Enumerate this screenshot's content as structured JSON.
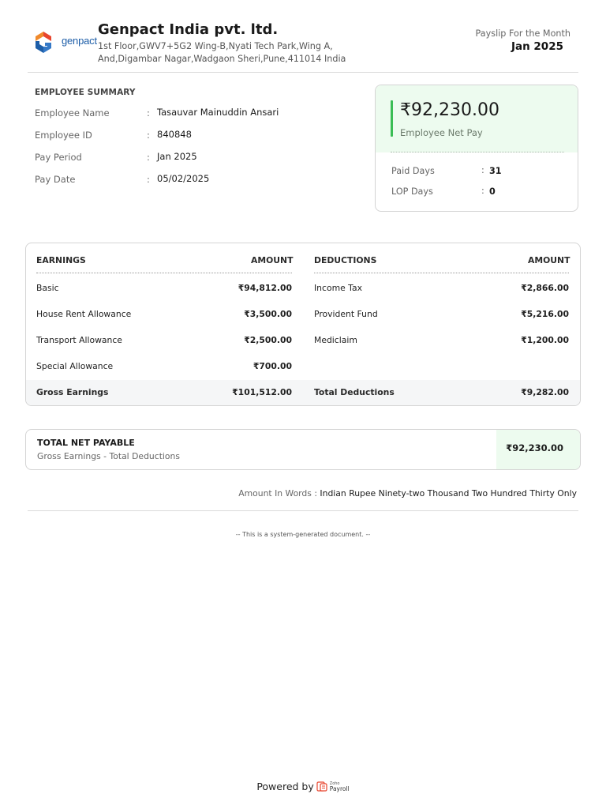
{
  "header": {
    "logo_text": "genpact",
    "company_name": "Genpact India pvt. ltd.",
    "address_line1": "1st Floor,GWV7+5G2 Wing-B,Nyati Tech Park,Wing A,",
    "address_line2": "And,Digambar Nagar,Wadgaon Sheri,Pune,411014 India",
    "payslip_label": "Payslip For the Month",
    "payslip_month": "Jan 2025"
  },
  "employee_summary": {
    "title": "EMPLOYEE SUMMARY",
    "rows": [
      {
        "label": "Employee Name",
        "value": "Tasauvar Mainuddin Ansari"
      },
      {
        "label": "Employee ID",
        "value": "840848"
      },
      {
        "label": "Pay Period",
        "value": "Jan 2025"
      },
      {
        "label": "Pay Date",
        "value": "05/02/2025"
      }
    ]
  },
  "net_pay_card": {
    "amount": "₹92,230.00",
    "label": "Employee Net Pay",
    "paid_days_label": "Paid Days",
    "paid_days_value": "31",
    "lop_days_label": "LOP Days",
    "lop_days_value": "0"
  },
  "earnings_table": {
    "earnings_header": "EARNINGS",
    "amount_header": "AMOUNT",
    "deductions_header": "DEDUCTIONS",
    "earnings": [
      {
        "label": "Basic",
        "amount": "₹94,812.00"
      },
      {
        "label": "House Rent Allowance",
        "amount": "₹3,500.00"
      },
      {
        "label": "Transport Allowance",
        "amount": "₹2,500.00"
      },
      {
        "label": "Special Allowance",
        "amount": "₹700.00"
      }
    ],
    "deductions": [
      {
        "label": "Income Tax",
        "amount": "₹2,866.00"
      },
      {
        "label": "Provident Fund",
        "amount": "₹5,216.00"
      },
      {
        "label": "Mediclaim",
        "amount": "₹1,200.00"
      }
    ],
    "gross_earnings_label": "Gross Earnings",
    "gross_earnings_amount": "₹101,512.00",
    "total_deductions_label": "Total Deductions",
    "total_deductions_amount": "₹9,282.00"
  },
  "total_net_payable": {
    "title": "TOTAL NET PAYABLE",
    "subtitle": "Gross Earnings - Total Deductions",
    "amount": "₹92,230.00"
  },
  "amount_in_words": {
    "label": "Amount In Words : ",
    "value": "Indian Rupee Ninety-two Thousand Two Hundred Thirty Only"
  },
  "system_note": "-- This is a system-generated document. --",
  "footer": {
    "powered_by": "Powered by",
    "brand_small": "Zoho",
    "brand_name": "Payroll"
  },
  "colors": {
    "accent_green": "#3bbd55",
    "light_green": "#edfbef",
    "brand_blue": "#1e5ea8",
    "brand_red": "#e8452e"
  }
}
